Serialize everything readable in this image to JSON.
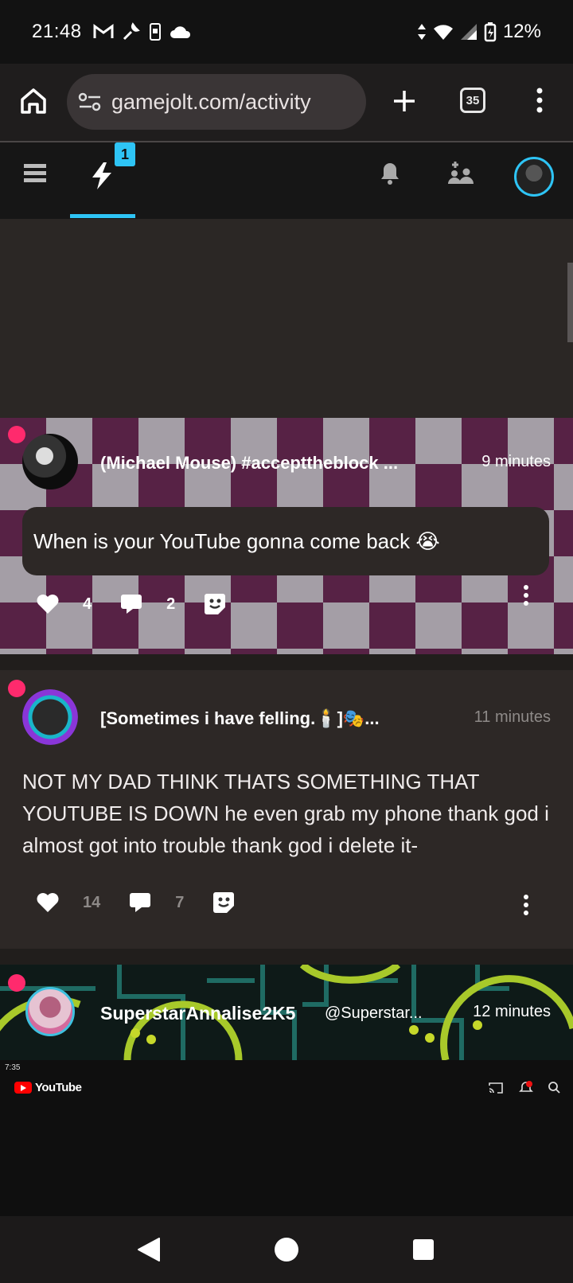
{
  "status_bar": {
    "time": "21:48",
    "left_icons": [
      "gmail-icon",
      "wrench-icon",
      "phone-icon",
      "cloud-icon"
    ],
    "right_icons": [
      "data-arrows-icon",
      "wifi-icon",
      "signal-icon",
      "battery-icon"
    ],
    "battery": "12%"
  },
  "browser": {
    "url": "gamejolt.com/activity",
    "tab_count": "35",
    "icons": [
      "home-icon",
      "site-settings-icon",
      "new-tab-icon",
      "tabs-icon",
      "more-icon"
    ]
  },
  "app_nav": {
    "activity_badge": "1",
    "icons": [
      "menu-icon",
      "activity-bolt-icon",
      "notifications-bell-icon",
      "friends-icon",
      "user-avatar"
    ],
    "accent": "#2ec4f5"
  },
  "posts": [
    {
      "username": "(Michael Mouse) #accepttheblock ...",
      "time": "9 minutes",
      "content": "When is your YouTube gonna come back 😭",
      "likes": "4",
      "comments": "2"
    },
    {
      "username": "[Sometimes i have felling.🕯️]🎭...",
      "time": "11 minutes",
      "content": "NOT MY DAD THINK THATS SOMETHING THAT YOUTUBE IS DOWN he even grab my phone thank god i almost got into trouble thank god i delete it-",
      "likes": "14",
      "comments": "7"
    },
    {
      "username": "SuperstarAnnalise2K5",
      "handle": "@Superstar...",
      "time": "12 minutes",
      "embed": {
        "status_time": "7:35",
        "app_name": "YouTube"
      }
    }
  ],
  "colors": {
    "live_dot": "#ff2a6d",
    "card_bg": "#2d2826",
    "checker_dark": "#6b2a55",
    "checker_light": "#c9c1cb"
  }
}
